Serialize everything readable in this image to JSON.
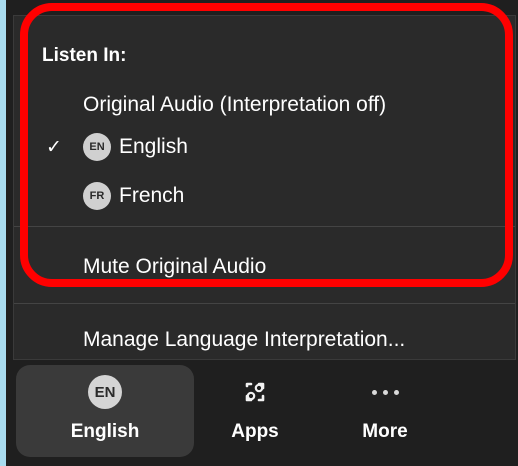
{
  "menu": {
    "title": "Listen In:",
    "items": [
      {
        "label": "Original Audio (Interpretation off)"
      },
      {
        "label": "English",
        "badge": "EN",
        "checked": true,
        "check_icon": "✓"
      },
      {
        "label": "French",
        "badge": "FR",
        "checked": false
      },
      {
        "label": "Mute Original Audio"
      },
      {
        "label": "Manage Language Interpretation..."
      }
    ]
  },
  "toolbar": {
    "buttons": [
      {
        "label": "English",
        "icon_text": "EN",
        "icon": "language-badge-icon"
      },
      {
        "label": "Apps",
        "icon": "apps-icon"
      },
      {
        "label": "More",
        "icon": "more-dots-icon"
      }
    ]
  },
  "colors": {
    "background": "#a9dcef",
    "panel": "#2a2a2a",
    "toolbar": "#1f1f1f",
    "highlight": "#ff0000",
    "text": "#ffffff"
  }
}
